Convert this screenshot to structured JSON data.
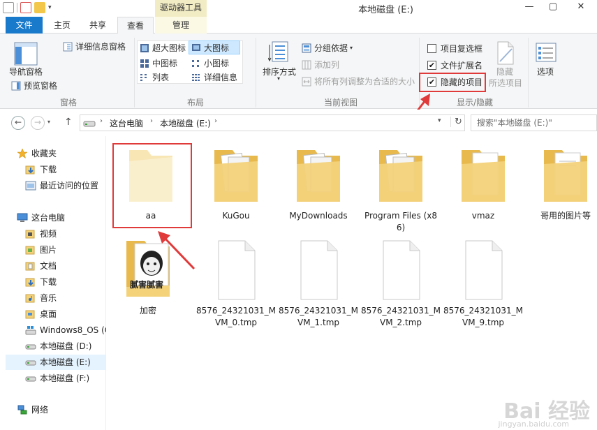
{
  "window": {
    "title": "本地磁盘 (E:)",
    "context_tab": "驱动器工具",
    "minimize": "—",
    "maximize": "▢",
    "close": "✕"
  },
  "tabs": {
    "file": "文件",
    "home": "主页",
    "share": "共享",
    "view": "查看",
    "manage": "管理"
  },
  "ribbon": {
    "panes": {
      "nav_pane": "导航窗格",
      "preview_pane": "预览窗格",
      "details_pane": "详细信息窗格",
      "group": "窗格"
    },
    "layout": {
      "extra_large": "超大图标",
      "large": "大图标",
      "medium": "中图标",
      "small": "小图标",
      "list": "列表",
      "details": "详细信息",
      "group": "布局"
    },
    "current_view": {
      "sort": "排序方式",
      "group_by": "分组依据",
      "add_columns": "添加列",
      "fit_columns": "将所有列调整为合适的大小",
      "group": "当前视图"
    },
    "show_hide": {
      "item_checkboxes": "项目复选框",
      "file_extensions": "文件扩展名",
      "hidden_items": "隐藏的项目",
      "hide_selected": "隐藏",
      "hide_selected_sub": "所选项目",
      "group": "显示/隐藏"
    },
    "options": "选项"
  },
  "address": {
    "crumbs": [
      "这台电脑",
      "本地磁盘 (E:)"
    ],
    "search_placeholder": "搜索\"本地磁盘 (E:)\""
  },
  "nav": {
    "favorites": "收藏夹",
    "downloads": "下载",
    "recent": "最近访问的位置",
    "this_pc": "这台电脑",
    "videos": "视频",
    "pictures": "图片",
    "documents": "文档",
    "downloads2": "下载",
    "music": "音乐",
    "desktop": "桌面",
    "win8": "Windows8_OS (C",
    "drive_d": "本地磁盘 (D:)",
    "drive_e": "本地磁盘 (E:)",
    "drive_f": "本地磁盘 (F:)",
    "network": "网络"
  },
  "files": [
    {
      "label": "aa",
      "kind": "folder-hidden"
    },
    {
      "label": "KuGou",
      "kind": "folder-docs"
    },
    {
      "label": "MyDownloads",
      "kind": "folder-docs"
    },
    {
      "label": "Program Files (x86)",
      "kind": "folder-docs"
    },
    {
      "label": "vmaz",
      "kind": "folder-paper"
    },
    {
      "label": "哥用的图片等",
      "kind": "folder-paper"
    },
    {
      "label": "加密",
      "kind": "folder-meme"
    },
    {
      "label": "8576_24321031_MVM_0.tmp",
      "kind": "file"
    },
    {
      "label": "8576_24321031_MVM_1.tmp",
      "kind": "file"
    },
    {
      "label": "8576_24321031_MVM_2.tmp",
      "kind": "file"
    },
    {
      "label": "8576_24321031_MVM_9.tmp",
      "kind": "file"
    }
  ],
  "meme_caption": "腻害腻害",
  "watermark": "Bai 经验",
  "watermark_sub": "jingyan.baidu.com",
  "colors": {
    "accent": "#1979ca",
    "highlight": "#e03a3a",
    "folder": "#f3d27a"
  }
}
